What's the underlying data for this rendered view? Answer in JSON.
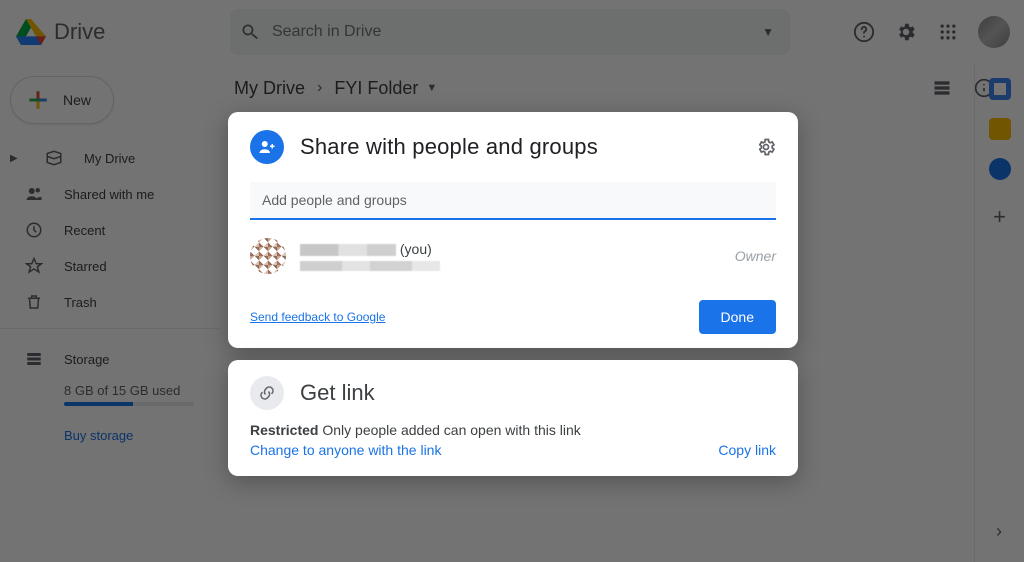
{
  "brand": "Drive",
  "search": {
    "placeholder": "Search in Drive"
  },
  "new_button": "New",
  "sidebar": {
    "items": [
      {
        "label": "My Drive"
      },
      {
        "label": "Shared with me"
      },
      {
        "label": "Recent"
      },
      {
        "label": "Starred"
      },
      {
        "label": "Trash"
      }
    ],
    "storage_label": "Storage",
    "storage_text": "8 GB of 15 GB used",
    "buy_label": "Buy storage"
  },
  "breadcrumb": {
    "root": "My Drive",
    "folder": "FYI Folder"
  },
  "share_dialog": {
    "title": "Share with people and groups",
    "input_placeholder": "Add people and groups",
    "you_suffix": "(you)",
    "owner_label": "Owner",
    "feedback": "Send feedback to Google",
    "done": "Done"
  },
  "link_dialog": {
    "title": "Get link",
    "restricted": "Restricted",
    "description": "Only people added can open with this link",
    "change": "Change to anyone with the link",
    "copy": "Copy link"
  }
}
